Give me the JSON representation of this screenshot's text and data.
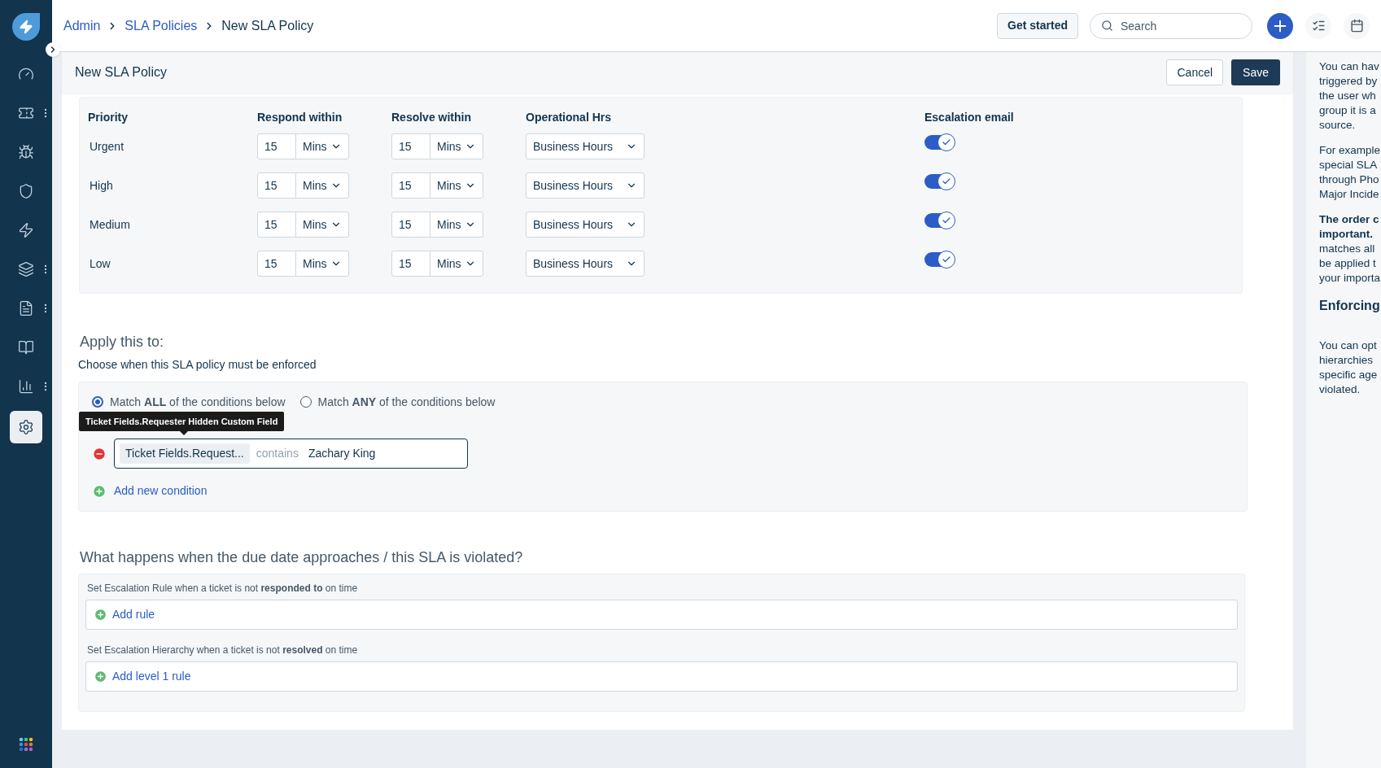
{
  "sidebar": {
    "items": [
      {
        "kind": "gauge",
        "selected": false,
        "menu": false
      },
      {
        "kind": "ticket",
        "selected": false,
        "menu": true
      },
      {
        "kind": "bug",
        "selected": false,
        "menu": false
      },
      {
        "kind": "shield",
        "selected": false,
        "menu": false
      },
      {
        "kind": "bolt",
        "selected": false,
        "menu": false
      },
      {
        "kind": "layers",
        "selected": false,
        "menu": true
      },
      {
        "kind": "document",
        "selected": false,
        "menu": true
      },
      {
        "kind": "book",
        "selected": false,
        "menu": false
      },
      {
        "kind": "chart",
        "selected": false,
        "menu": true
      },
      {
        "kind": "settings",
        "selected": true,
        "menu": false
      }
    ]
  },
  "breadcrumbs": [
    {
      "label": "Admin",
      "link": true
    },
    {
      "label": "SLA Policies",
      "link": true
    },
    {
      "label": "New SLA Policy",
      "link": false
    }
  ],
  "top_bar": {
    "get_started": "Get started",
    "search": {
      "placeholder": "Search"
    }
  },
  "page": {
    "title": "New SLA Policy",
    "cancel": "Cancel",
    "save": "Save"
  },
  "sla_table": {
    "columns": [
      "Priority",
      "Respond within",
      "Resolve within",
      "Operational Hrs",
      "Escalation email"
    ],
    "rows": [
      {
        "priority": "Urgent",
        "respond": {
          "value": "15",
          "unit": "Mins"
        },
        "resolve": {
          "value": "15",
          "unit": "Mins"
        },
        "hours": "Business Hours",
        "escalation_email": true
      },
      {
        "priority": "High",
        "respond": {
          "value": "15",
          "unit": "Mins"
        },
        "resolve": {
          "value": "15",
          "unit": "Mins"
        },
        "hours": "Business Hours",
        "escalation_email": true
      },
      {
        "priority": "Medium",
        "respond": {
          "value": "15",
          "unit": "Mins"
        },
        "resolve": {
          "value": "15",
          "unit": "Mins"
        },
        "hours": "Business Hours",
        "escalation_email": true
      },
      {
        "priority": "Low",
        "respond": {
          "value": "15",
          "unit": "Mins"
        },
        "resolve": {
          "value": "15",
          "unit": "Mins"
        },
        "hours": "Business Hours",
        "escalation_email": true
      }
    ]
  },
  "apply": {
    "title": "Apply this to:",
    "subtitle": "Choose when this SLA policy must be enforced",
    "match_options": [
      {
        "label": "Match **ALL** of the conditions below",
        "selected": true
      },
      {
        "label": "Match **ANY** of the conditions below",
        "selected": false
      }
    ],
    "tooltip": "Ticket Fields.Requester Hidden Custom Field",
    "conditions": [
      {
        "field": "Ticket Fields.Request...",
        "operator": "contains",
        "value": "Zachary King"
      }
    ],
    "add_condition": "Add new condition"
  },
  "escalation": {
    "title": "What happens when the due date approaches / this SLA is violated?",
    "sections": [
      {
        "label": "Set Escalation Rule when a ticket is not **responded to** on time",
        "action": "Add rule"
      },
      {
        "label": "Set Escalation Hierarchy when a ticket is not **resolved** on time",
        "action": "Add level 1 rule"
      }
    ]
  },
  "help_panel": {
    "blocks": [
      {
        "kind": "text",
        "lines": [
          {
            "text": "You can hav",
            "bold": false
          },
          {
            "text": "triggered by",
            "bold": false
          },
          {
            "text": "the user wh",
            "bold": false
          },
          {
            "text": "group it is a",
            "bold": false
          },
          {
            "text": "source.",
            "bold": false
          }
        ]
      },
      {
        "kind": "text",
        "lines": [
          {
            "text": "For example",
            "bold": false
          },
          {
            "text": "special SLA",
            "bold": false
          },
          {
            "text": "through Pho",
            "bold": false
          },
          {
            "text": "Major Incide",
            "bold": false
          }
        ]
      },
      {
        "kind": "text",
        "lines": [
          {
            "text": "The order c",
            "bold": true
          },
          {
            "text": "important.",
            "bold": true
          },
          {
            "text": "matches all",
            "bold": false
          },
          {
            "text": "be applied t",
            "bold": false
          },
          {
            "text": "your importa",
            "bold": false
          }
        ]
      },
      {
        "kind": "heading",
        "lines": [
          {
            "text": "Enforcing",
            "bold": true
          }
        ]
      },
      {
        "kind": "text",
        "lines": [
          {
            "text": "You can opt",
            "bold": false
          },
          {
            "text": "hierarchies",
            "bold": false
          },
          {
            "text": "specific age",
            "bold": false
          },
          {
            "text": "violated.",
            "bold": false
          }
        ]
      }
    ]
  }
}
